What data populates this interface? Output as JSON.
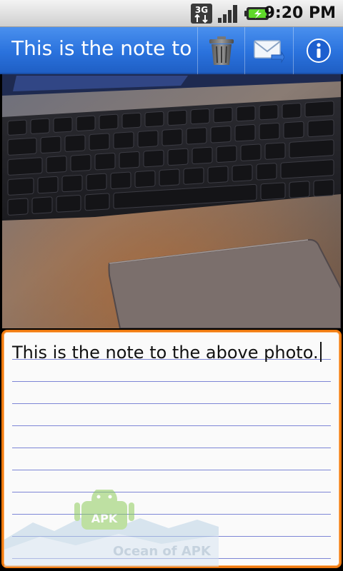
{
  "status_bar": {
    "network": "3G",
    "time": "9:20 PM"
  },
  "action_bar": {
    "title": "This is the note to",
    "actions": [
      "delete",
      "share-email",
      "info"
    ]
  },
  "note": {
    "text": "This is the note to the above photo."
  },
  "watermark": {
    "label": "APK",
    "text": "Ocean of APK"
  },
  "colors": {
    "action_bar": "#2a72dd",
    "focus_border": "#f07b10",
    "rule_lines": "#7d86d6"
  }
}
